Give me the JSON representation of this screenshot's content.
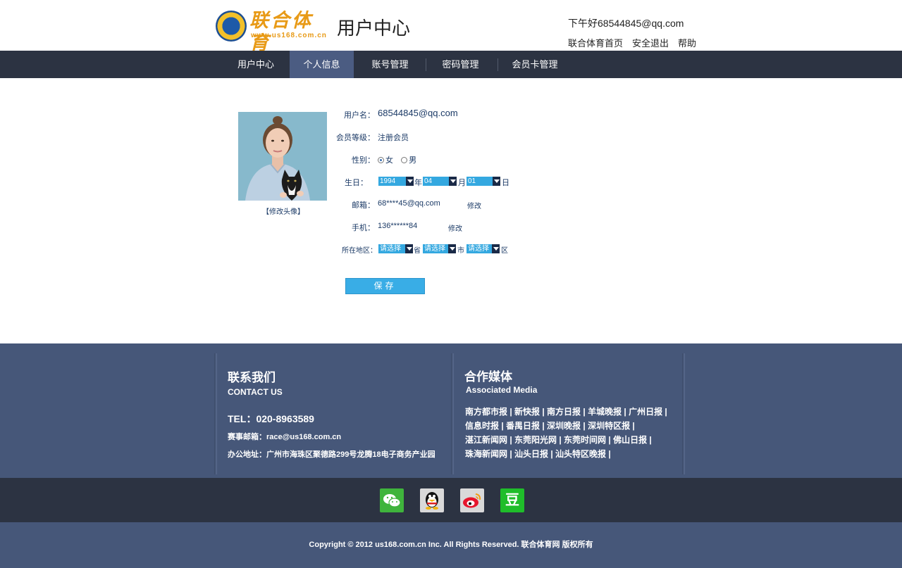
{
  "header": {
    "logo_text": "联合体育",
    "logo_url": "www.us168.com.cn",
    "page_title": "用户中心",
    "greeting": "下午好68544845@qq.com",
    "links": [
      "联合体育首页",
      "安全退出",
      "帮助"
    ]
  },
  "nav": {
    "items": [
      "用户中心",
      "个人信息",
      "账号管理",
      "密码管理",
      "会员卡管理"
    ],
    "active": "个人信息"
  },
  "profile": {
    "avatar_change": "【修改头像】",
    "username_label": "用户名：",
    "username": "68544845@qq.com",
    "level_label": "会员等级：",
    "level": "注册会员",
    "gender_label": "性别：",
    "gender_options": [
      "女",
      "男"
    ],
    "gender_selected": "女",
    "birthday_label": "生日：",
    "birth_year": "1994",
    "birth_month": "04",
    "birth_day": "01",
    "year_unit": "年",
    "month_unit": "月",
    "day_unit": "日",
    "email_label": "邮箱：",
    "email": "68****45@qq.com",
    "email_edit": "修改",
    "phone_label": "手机：",
    "phone": "136******84",
    "phone_edit": "修改",
    "region_label": "所在地区：",
    "province_placeholder": "请选择",
    "province_unit": "省",
    "city_placeholder": "请选择",
    "city_unit": "市",
    "district_placeholder": "请选择",
    "district_unit": "区",
    "save_label": "保存"
  },
  "footer": {
    "contact_title": "联系我们",
    "contact_sub": "CONTACT US",
    "tel": "TEL：020-8963589",
    "email": "赛事邮箱：race@us168.com.cn",
    "address": "办公地址：广州市海珠区聚德路299号龙腾18电子商务产业园",
    "media_title": "合作媒体",
    "media_sub": "Associated Media",
    "media_rows": [
      "南方都市报 | 新快报 | 南方日报 | 羊城晚报 | 广州日报 |",
      "信息时报 | 番禺日报 | 深圳晚报 | 深圳特区报 |",
      "湛江新闻网 | 东莞阳光网 | 东莞时间网 | 佛山日报 |",
      "珠海新闻网 | 汕头日报 | 汕头特区晚报 |"
    ],
    "social_icons": [
      "wechat-icon",
      "qq-icon",
      "weibo-icon",
      "douban-icon"
    ],
    "douban_glyph": "豆",
    "copyright": "Copyright © 2012 us168.com.cn Inc. All Rights Reserved. 联合体育网 版权所有"
  },
  "colors": {
    "nav_bg": "#2c3342",
    "nav_active": "#4b5c82",
    "footer_bg": "#465779",
    "accent": "#39ade6",
    "brand_orange": "#e89a16"
  }
}
